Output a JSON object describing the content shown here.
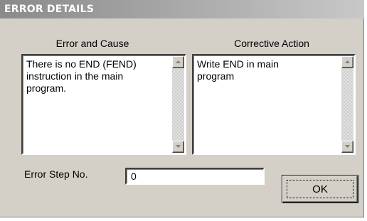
{
  "window": {
    "title": "ERROR DETAILS"
  },
  "error_panel": {
    "label": "Error and Cause",
    "text": "There is no END (FEND)\ninstruction in the main\nprogram."
  },
  "action_panel": {
    "label": "Corrective Action",
    "text": "Write END in main\nprogram"
  },
  "error_step": {
    "label": "Error Step No.",
    "value": "0"
  },
  "buttons": {
    "ok_label": "OK"
  },
  "icons": {
    "scroll_up": "scroll-up-arrow-icon",
    "scroll_down": "scroll-down-arrow-icon"
  },
  "colors": {
    "dialog_bg": "#d4d0c8",
    "titlebar_gradient_start": "#8a8a8a",
    "titlebar_gradient_end": "#c8c8c8",
    "field_bg": "#ffffff"
  }
}
